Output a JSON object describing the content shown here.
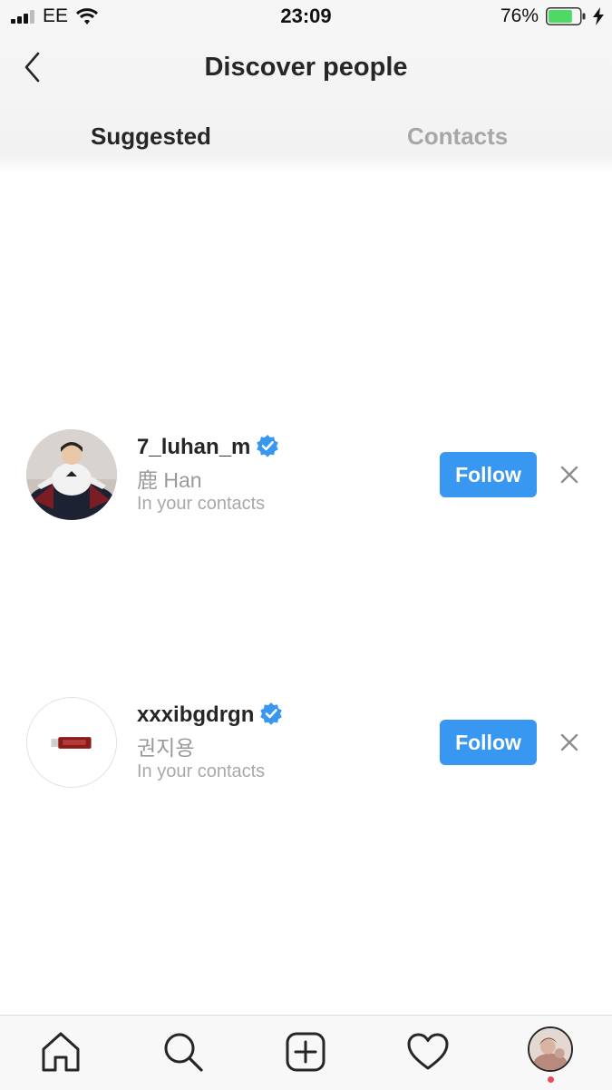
{
  "status_bar": {
    "carrier": "EE",
    "time": "23:09",
    "battery_percent": "76%",
    "battery_level": 0.76,
    "battery_color": "#4cd964",
    "charging": true
  },
  "header": {
    "title": "Discover people",
    "back_icon": "chevron-left-icon"
  },
  "tabs": [
    {
      "label": "Suggested",
      "active": true
    },
    {
      "label": "Contacts",
      "active": false
    }
  ],
  "suggestions": [
    {
      "username": "7_luhan_m",
      "verified": true,
      "full_name": "鹿 Han",
      "context": "In your contacts",
      "follow_label": "Follow",
      "dismiss_icon": "close-icon"
    },
    {
      "username": "xxxibgdrgn",
      "verified": true,
      "full_name": "권지용",
      "context": "In your contacts",
      "follow_label": "Follow",
      "dismiss_icon": "close-icon"
    }
  ],
  "tab_bar": {
    "items": [
      "home-icon",
      "search-icon",
      "add-post-icon",
      "heart-icon",
      "profile-avatar"
    ],
    "has_notification": true
  },
  "colors": {
    "accent": "#3897f0",
    "notification": "#ed4956",
    "verified_badge": "#3897f0"
  }
}
